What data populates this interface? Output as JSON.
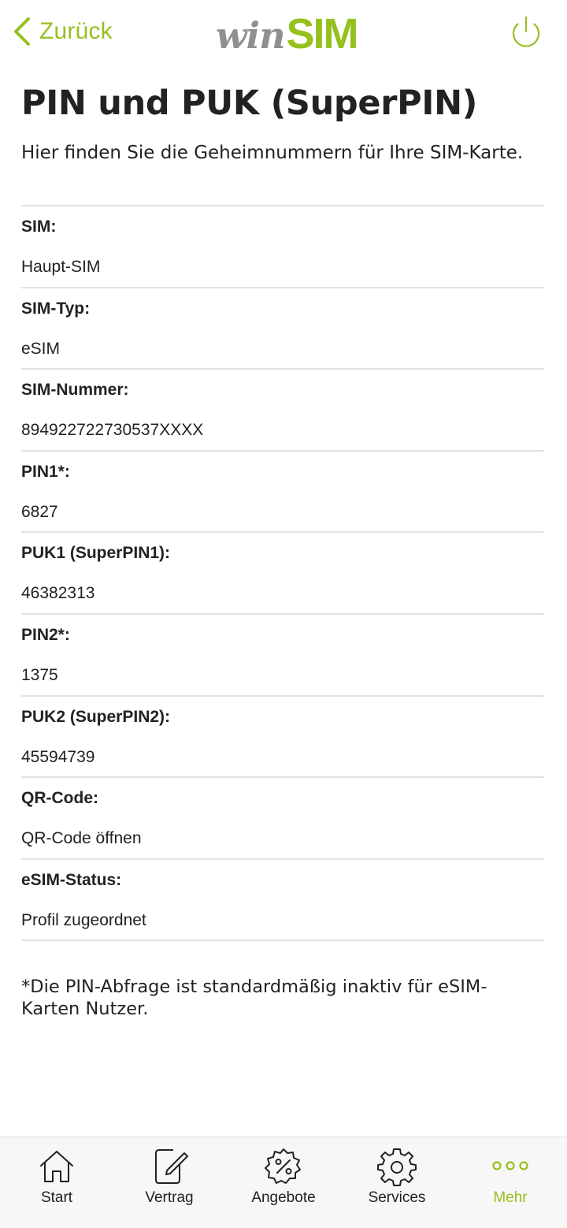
{
  "colors": {
    "accent": "#95c11f",
    "text": "#222222",
    "logo_gray": "#8f8f8f",
    "divider": "#e2e2e2"
  },
  "header": {
    "back_label": "Zurück",
    "logo_win": "win",
    "logo_sim": "SIM",
    "back_icon": "chevron-left-icon",
    "power_icon": "power-icon"
  },
  "page": {
    "title": "PIN und PUK (SuperPIN)",
    "subtitle": "Hier finden Sie die Geheimnummern für Ihre SIM-Karte."
  },
  "details": [
    {
      "label": "SIM:",
      "value": "Haupt-SIM"
    },
    {
      "label": "SIM-Typ:",
      "value": "eSIM"
    },
    {
      "label": "SIM-Nummer:",
      "value": "894922722730537XXXX"
    },
    {
      "label": "PIN1*:",
      "value": "6827"
    },
    {
      "label": "PUK1 (SuperPIN1):",
      "value": "46382313"
    },
    {
      "label": "PIN2*:",
      "value": "1375"
    },
    {
      "label": "PUK2 (SuperPIN2):",
      "value": "45594739"
    },
    {
      "label": "QR-Code:",
      "value": "QR-Code öffnen"
    },
    {
      "label": "eSIM-Status:",
      "value": "Profil zugeordnet"
    }
  ],
  "footnote": "*Die PIN-Abfrage ist standardmäßig inaktiv für eSIM-Karten Nutzer.",
  "tabbar": {
    "tabs": [
      {
        "label": "Start",
        "icon": "home-icon",
        "active": false
      },
      {
        "label": "Vertrag",
        "icon": "contract-edit-icon",
        "active": false
      },
      {
        "label": "Angebote",
        "icon": "percent-badge-icon",
        "active": false
      },
      {
        "label": "Services",
        "icon": "gear-icon",
        "active": false
      },
      {
        "label": "Mehr",
        "icon": "more-dots-icon",
        "active": true
      }
    ]
  }
}
